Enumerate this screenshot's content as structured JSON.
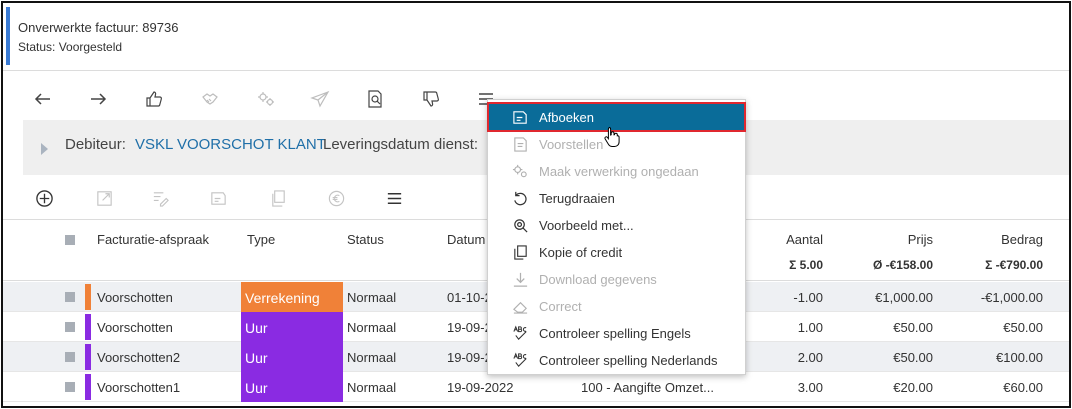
{
  "header": {
    "title": "Onverwerkte factuur: 89736",
    "status": "Status: Voorgesteld",
    "accent_color": "#3a7bd5"
  },
  "toolbar": {
    "icons": [
      "arrow-left-icon",
      "arrow-right-icon",
      "thumbs-up-icon",
      "handshake-icon",
      "gears-icon",
      "send-icon",
      "search-document-icon",
      "thumbs-down-icon",
      "menu-icon"
    ]
  },
  "debtor": {
    "label": "Debiteur:",
    "value": "VSKL VOORSCHOT KLANT",
    "delivery_label": "Leveringsdatum dienst:"
  },
  "table": {
    "columns": {
      "agreement": "Facturatie-afspraak",
      "type": "Type",
      "status": "Status",
      "date": "Datum",
      "quantity": "Aantal",
      "price": "Prijs",
      "amount": "Bedrag"
    },
    "totals": {
      "quantity": "Σ 5.00",
      "price": "Ø -€158.00",
      "amount": "Σ -€790.00"
    },
    "rows": [
      {
        "agreement": "Voorschotten",
        "type": "Verrekening",
        "status": "Normaal",
        "date": "01-10-2",
        "desc": "",
        "quantity": "-1.00",
        "price": "€1,000.00",
        "amount": "-€1,000.00",
        "color": "#f08138"
      },
      {
        "agreement": "Voorschotten",
        "type": "Uur",
        "status": "Normaal",
        "date": "19-09-2",
        "desc": "",
        "quantity": "1.00",
        "price": "€50.00",
        "amount": "€50.00",
        "color": "#8a2be2"
      },
      {
        "agreement": "Voorschotten2",
        "type": "Uur",
        "status": "Normaal",
        "date": "19-09-2",
        "desc": "",
        "quantity": "2.00",
        "price": "€50.00",
        "amount": "€100.00",
        "color": "#8a2be2"
      },
      {
        "agreement": "Voorschotten1",
        "type": "Uur",
        "status": "Normaal",
        "date": "19-09-2022",
        "desc": "100 - Aangifte Omzet...",
        "quantity": "3.00",
        "price": "€20.00",
        "amount": "€60.00",
        "color": "#8a2be2"
      }
    ]
  },
  "menu": {
    "items": [
      {
        "label": "Afboeken",
        "icon": "write-off-icon",
        "state": "active"
      },
      {
        "label": "Voorstellen",
        "icon": "propose-icon",
        "state": "disabled"
      },
      {
        "label": "Maak verwerking ongedaan",
        "icon": "undo-processing-icon",
        "state": "disabled"
      },
      {
        "label": "Terugdraaien",
        "icon": "rollback-icon",
        "state": "enabled"
      },
      {
        "label": "Voorbeeld met...",
        "icon": "preview-icon",
        "state": "enabled"
      },
      {
        "label": "Kopie of credit",
        "icon": "copy-icon",
        "state": "enabled"
      },
      {
        "label": "Download gegevens",
        "icon": "download-icon",
        "state": "disabled"
      },
      {
        "label": "Correct",
        "icon": "eraser-icon",
        "state": "disabled"
      },
      {
        "label": "Controleer spelling Engels",
        "icon": "spellcheck-en-icon",
        "state": "enabled"
      },
      {
        "label": "Controleer spelling Nederlands",
        "icon": "spellcheck-nl-icon",
        "state": "enabled"
      }
    ],
    "active_color": "#0a6c99",
    "highlight_border": "#e0282f"
  }
}
